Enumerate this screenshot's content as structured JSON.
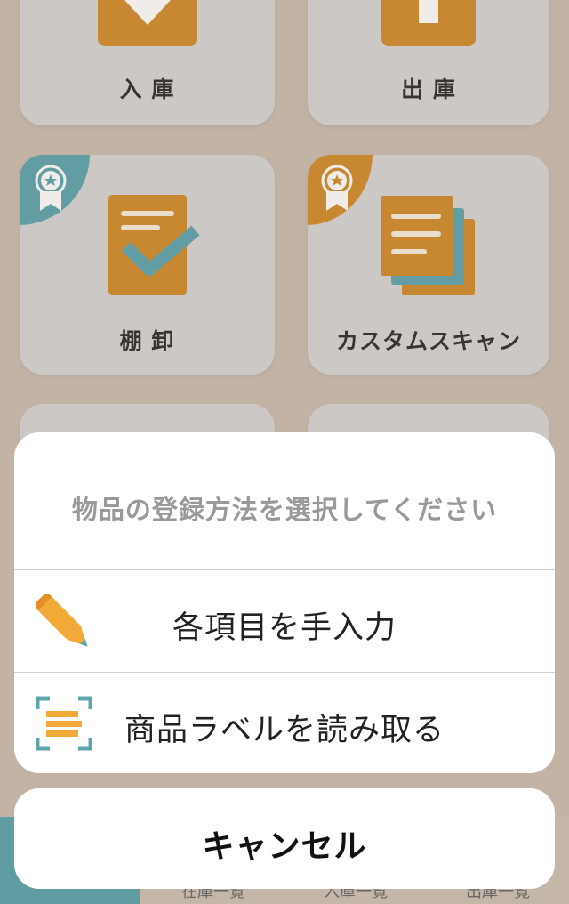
{
  "tiles": {
    "receiving": {
      "label": "入 庫"
    },
    "shipping": {
      "label": "出 庫"
    },
    "inventory": {
      "label": "棚 卸"
    },
    "custom_scan": {
      "label": "カスタムスキャン"
    }
  },
  "tab_bar": {
    "tabs": [
      {
        "label": ""
      },
      {
        "label": "在庫一覧"
      },
      {
        "label": "入庫一覧"
      },
      {
        "label": "出庫一覧"
      }
    ]
  },
  "action_sheet": {
    "title": "物品の登録方法を選択してください",
    "options": [
      {
        "label": "各項目を手入力",
        "icon": "pencil-icon"
      },
      {
        "label": "商品ラベルを読み取る",
        "icon": "scan-label-icon"
      }
    ],
    "cancel_label": "キャンセル"
  },
  "colors": {
    "accent_orange": "#d38e2e",
    "accent_teal": "#5ea6ae",
    "tile_bg": "#d7d7d6",
    "background": "#ccbfb1"
  }
}
